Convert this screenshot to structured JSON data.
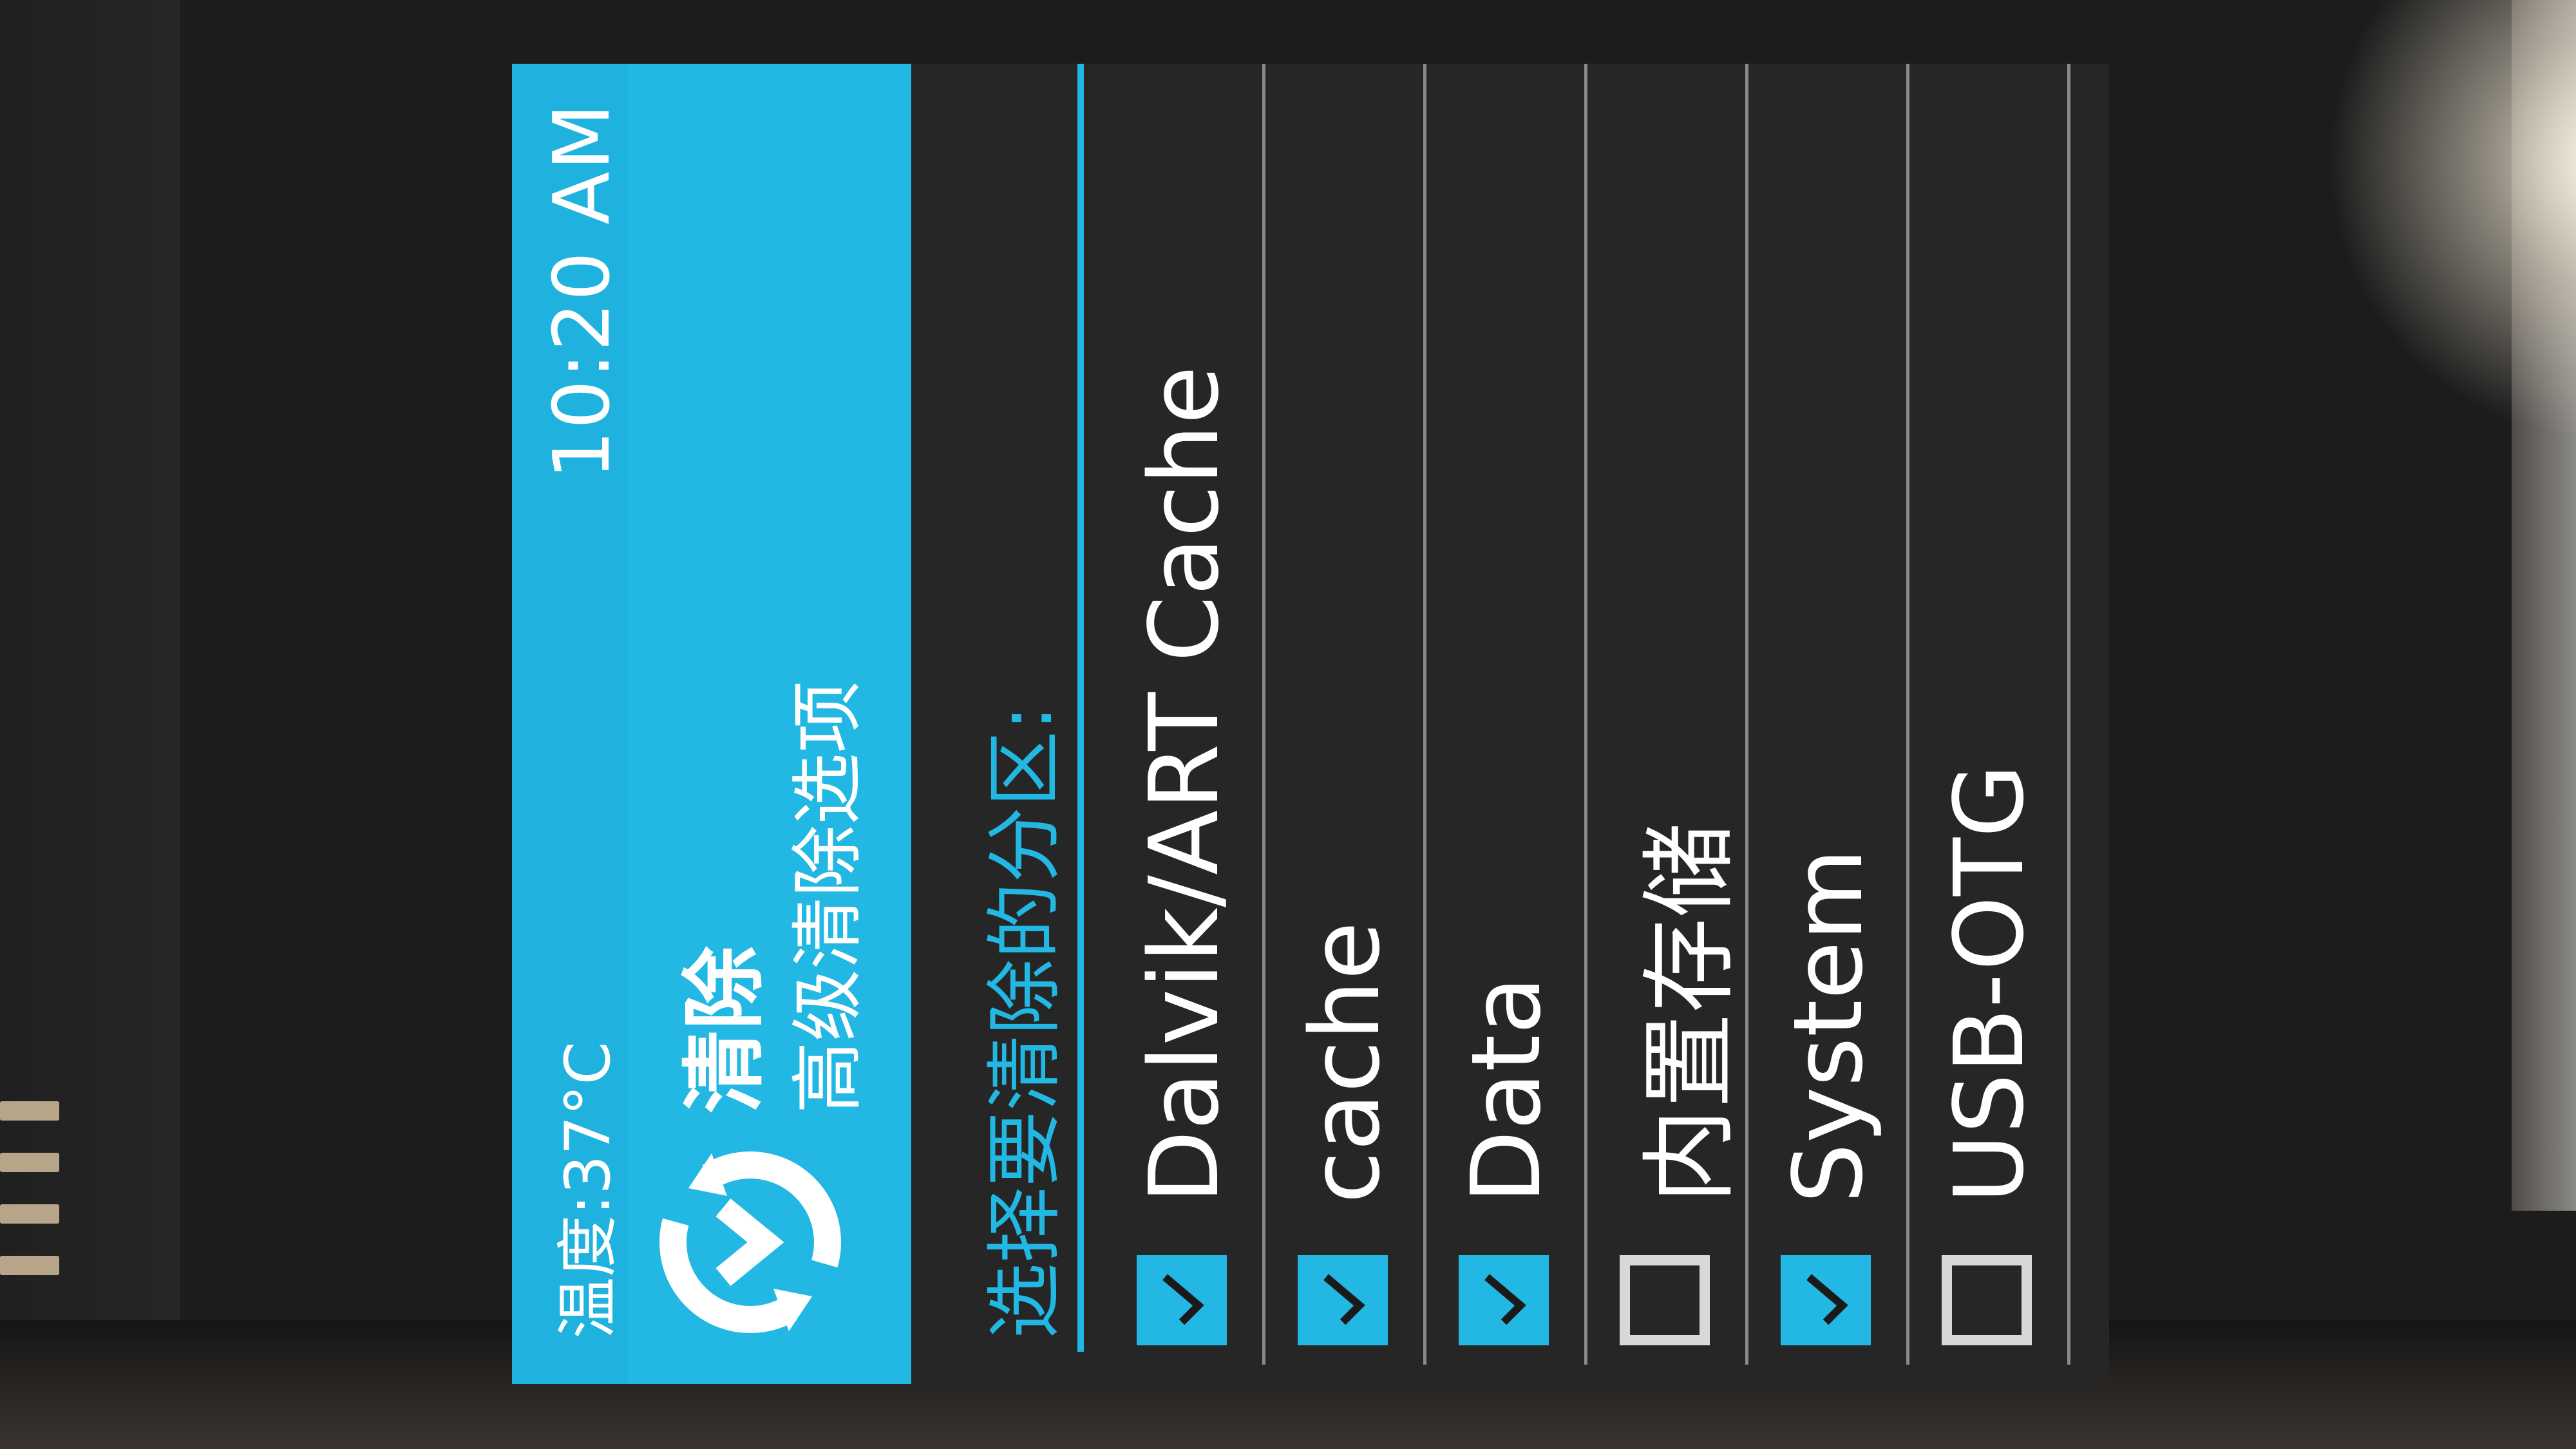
{
  "status_bar": {
    "temperature": "温度:37°C",
    "time": "10:20 AM"
  },
  "header": {
    "title": "清除",
    "subtitle": "高级清除选项"
  },
  "wipe": {
    "prompt": "选择要清除的分区:",
    "partitions": [
      {
        "label": "Dalvik/ART Cache",
        "checked": true
      },
      {
        "label": "cache",
        "checked": true
      },
      {
        "label": "Data",
        "checked": true
      },
      {
        "label": "内置存储",
        "checked": false
      },
      {
        "label": "System",
        "checked": true
      },
      {
        "label": "USB-OTG",
        "checked": false
      }
    ]
  },
  "colors": {
    "accent": "#22b8e3",
    "background": "#262626",
    "text": "#ffffff"
  }
}
